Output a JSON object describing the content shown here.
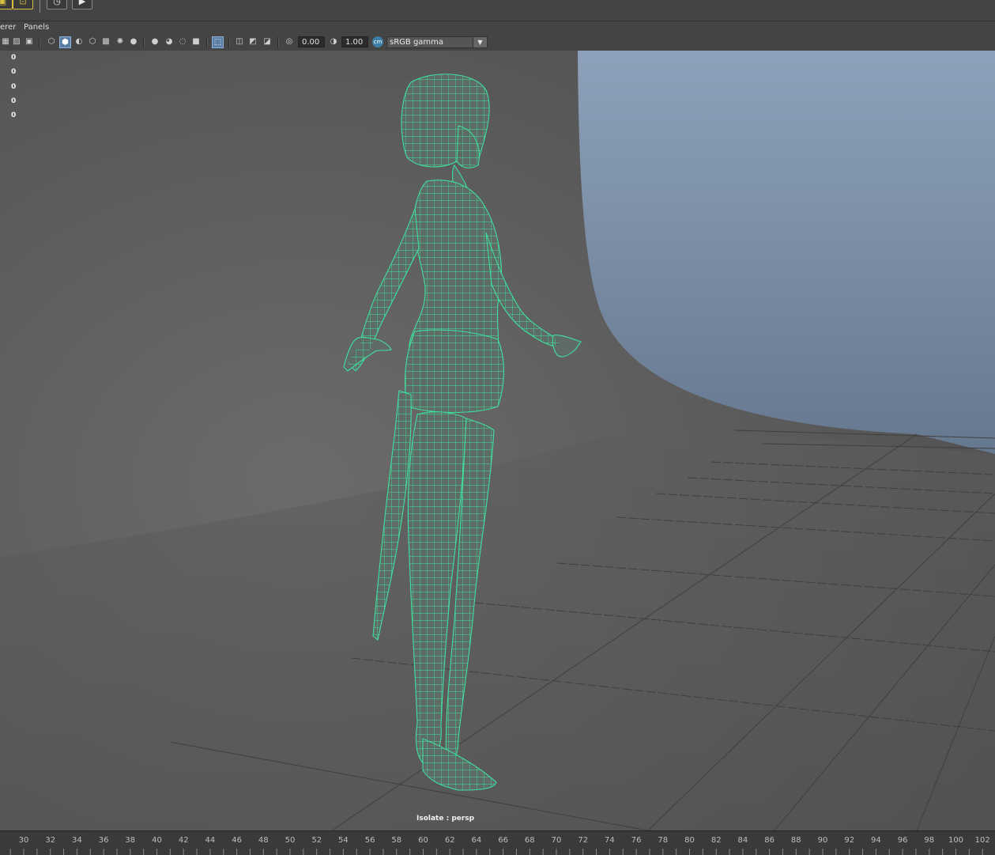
{
  "menubar": {
    "renderer_fragment": "erer",
    "panels": "Panels"
  },
  "toolbar": {
    "exposure_value": "0.00",
    "gamma_value": "1.00",
    "color_space": "sRGB gamma"
  },
  "hud": {
    "values": [
      "0",
      "0",
      "0",
      "0",
      "0"
    ]
  },
  "viewport": {
    "isolate_label": "Isolate : persp",
    "wireframe_color": "#3fe0a0",
    "background_top": "#7a90ab"
  },
  "timeline": {
    "ticks": [
      "30",
      "32",
      "34",
      "36",
      "38",
      "40",
      "42",
      "44",
      "46",
      "48",
      "50",
      "52",
      "54",
      "56",
      "58",
      "60",
      "62",
      "64",
      "66",
      "68",
      "70",
      "72",
      "74",
      "76",
      "78",
      "80",
      "82",
      "84",
      "86",
      "88",
      "90",
      "92",
      "94",
      "96",
      "98",
      "100",
      "102"
    ]
  }
}
